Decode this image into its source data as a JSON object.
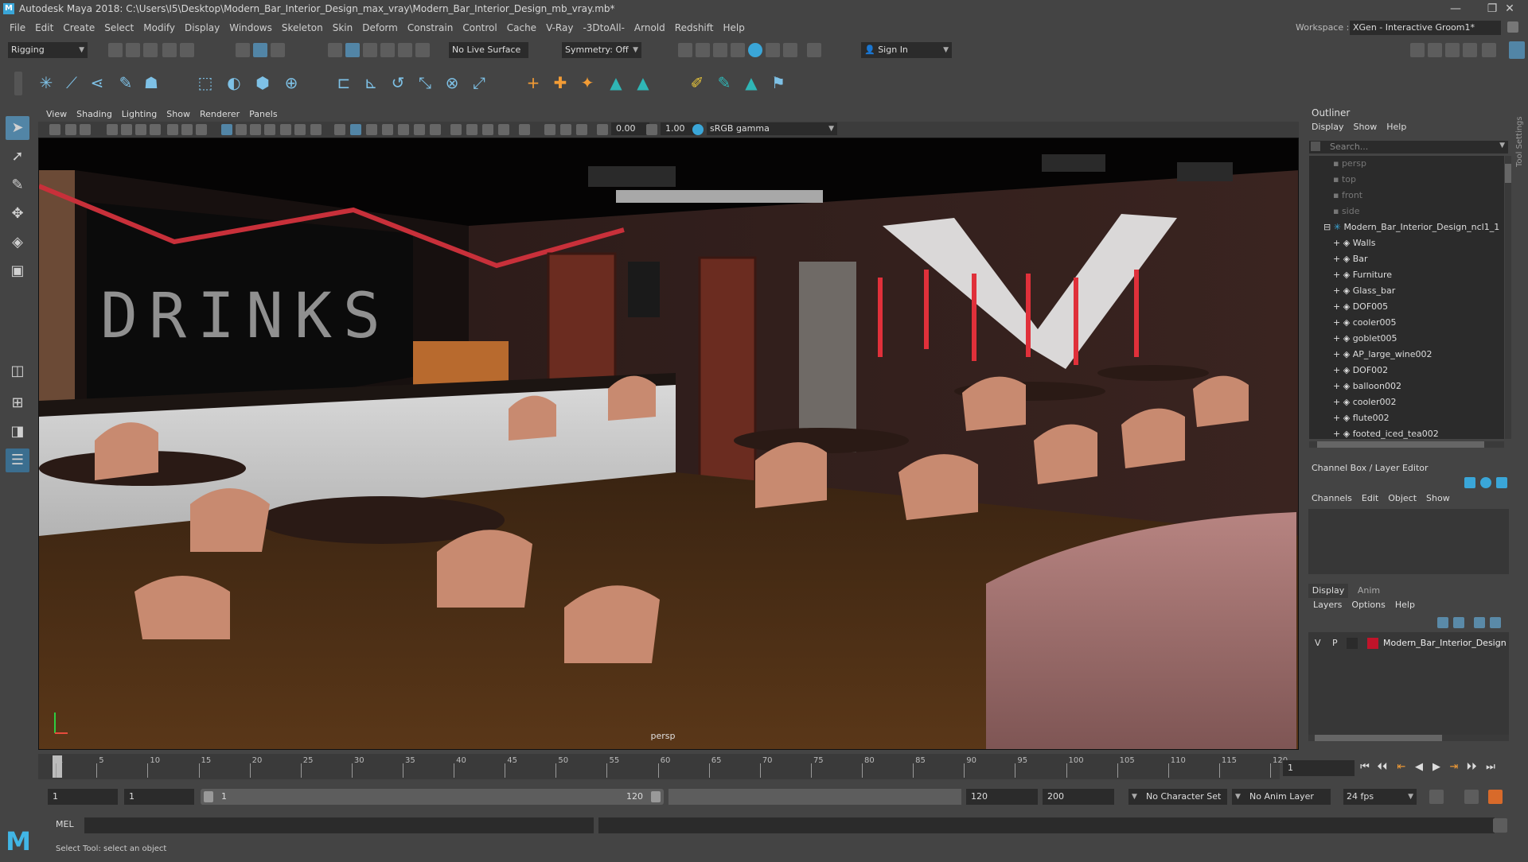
{
  "window": {
    "app_icon": "M",
    "title": "Autodesk Maya 2018: C:\\Users\\I5\\Desktop\\Modern_Bar_Interior_Design_max_vray\\Modern_Bar_Interior_Design_mb_vray.mb*",
    "controls": {
      "minimize": "—",
      "restore": "❐",
      "close": "✕"
    }
  },
  "menubar": {
    "items": [
      "File",
      "Edit",
      "Create",
      "Select",
      "Modify",
      "Display",
      "Windows",
      "Skeleton",
      "Skin",
      "Deform",
      "Constrain",
      "Control",
      "Cache",
      "V-Ray",
      "-3DtoAll-",
      "Arnold",
      "Redshift",
      "Help"
    ],
    "workspace_label": "Workspace :",
    "workspace_value": "XGen - Interactive Groom1*"
  },
  "statusline": {
    "mode": "Rigging",
    "live_surface": "No Live Surface",
    "symmetry": "Symmetry: Off",
    "sign_in": "Sign In"
  },
  "viewport": {
    "menu": [
      "View",
      "Shading",
      "Lighting",
      "Show",
      "Renderer",
      "Panels"
    ],
    "exposure": "0.00",
    "gamma": "1.00",
    "color_space": "sRGB gamma",
    "camera_label": "persp",
    "scene_sign": "DRINKS"
  },
  "outliner": {
    "title": "Outliner",
    "menu": [
      "Display",
      "Show",
      "Help"
    ],
    "search_placeholder": "Search...",
    "cameras": [
      "persp",
      "top",
      "front",
      "side"
    ],
    "root": "Modern_Bar_Interior_Design_ncl1_1",
    "children": [
      "Walls",
      "Bar",
      "Furniture",
      "Glass_bar",
      "DOF005",
      "cooler005",
      "goblet005",
      "AP_large_wine002",
      "DOF002",
      "balloon002",
      "cooler002",
      "flute002",
      "footed_iced_tea002"
    ]
  },
  "channelbox": {
    "title": "Channel Box / Layer Editor",
    "menu": [
      "Channels",
      "Edit",
      "Object",
      "Show"
    ]
  },
  "layer_editor": {
    "tabs": [
      "Display",
      "Anim"
    ],
    "menu": [
      "Layers",
      "Options",
      "Help"
    ],
    "layer": {
      "v": "V",
      "p": "P",
      "name": "Modern_Bar_Interior_Design",
      "color": "#c0142a"
    }
  },
  "timeline": {
    "tick_labels": [
      "1",
      "5",
      "10",
      "15",
      "20",
      "25",
      "30",
      "35",
      "40",
      "45",
      "50",
      "55",
      "60",
      "65",
      "70",
      "75",
      "80",
      "85",
      "90",
      "95",
      "100",
      "105",
      "110",
      "115",
      "120"
    ],
    "current_frame": "1"
  },
  "range": {
    "start": "1",
    "playback_start": "1",
    "slider_start": "1",
    "slider_end": "120",
    "playback_end": "120",
    "end": "200",
    "character_set": "No Character Set",
    "anim_layer": "No Anim Layer",
    "fps": "24 fps"
  },
  "commandline": {
    "label": "MEL"
  },
  "helpline": {
    "text": "Select Tool: select an object"
  },
  "sidebar_tab": {
    "label": "Tool Settings"
  }
}
